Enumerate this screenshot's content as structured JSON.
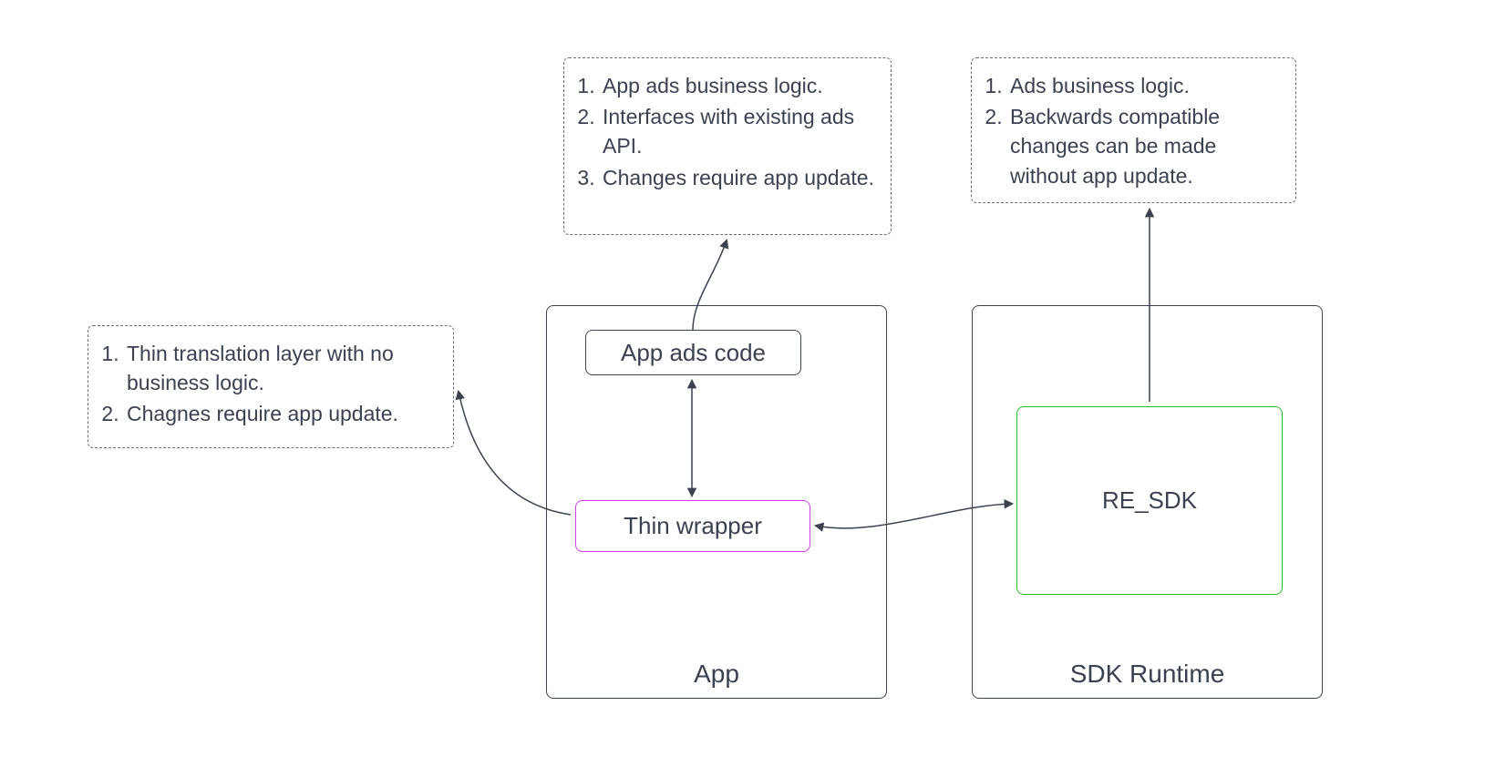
{
  "annotations": {
    "left": {
      "items": [
        "Thin translation layer with no business logic.",
        "Chagnes require app update."
      ]
    },
    "top_center": {
      "items": [
        "App ads business logic.",
        "Interfaces with existing ads API.",
        "Changes require app update."
      ]
    },
    "top_right": {
      "items": [
        "Ads business logic.",
        "Backwards compatible changes can be made without app update."
      ]
    }
  },
  "boxes": {
    "app": {
      "label": "App"
    },
    "sdk_runtime": {
      "label": "SDK Runtime"
    },
    "app_ads_code": {
      "label": "App ads code"
    },
    "thin_wrapper": {
      "label": "Thin wrapper"
    },
    "re_sdk": {
      "label": "RE_SDK"
    }
  }
}
